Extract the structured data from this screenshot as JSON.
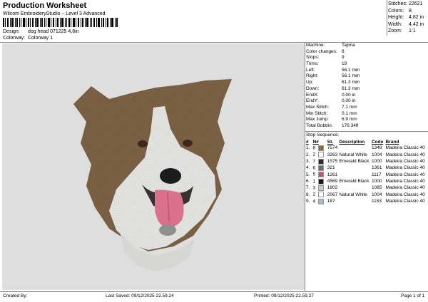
{
  "header": {
    "title": "Production Worksheet",
    "subtitle": "Wilcom EmbroideryStudio – Level 3 Advanced",
    "design_label": "Design:",
    "design_value": "dog head 071225 4,8in",
    "colorway_label": "Colorway:",
    "colorway_value": "Colorway 1"
  },
  "stats": [
    {
      "label": "Stitches:",
      "value": "22621"
    },
    {
      "label": "Colors:",
      "value": "8"
    },
    {
      "label": "Height:",
      "value": "4.82 in"
    },
    {
      "label": "Width:",
      "value": "4.42 in"
    },
    {
      "label": "Zoom:",
      "value": "1:1"
    }
  ],
  "info": [
    {
      "label": "Machine:",
      "value": "Tajima"
    },
    {
      "label": "Color changes:",
      "value": "8"
    },
    {
      "label": "Stops:",
      "value": "9"
    },
    {
      "label": "Trims:",
      "value": "19"
    },
    {
      "label": "Left:",
      "value": "56.1 mm"
    },
    {
      "label": "Right:",
      "value": "56.1 mm"
    },
    {
      "label": "Up:",
      "value": "61.3 mm"
    },
    {
      "label": "Down:",
      "value": "61.3 mm"
    },
    {
      "label": "EndX:",
      "value": "0.00 in"
    },
    {
      "label": "EndY:",
      "value": "0.00 in"
    },
    {
      "label": "Max Stitch:",
      "value": "7.1 mm"
    },
    {
      "label": "Min Stitch:",
      "value": "0.1 mm"
    },
    {
      "label": "Max Jump:",
      "value": "6.9 mm"
    },
    {
      "label": "Total Bobbin:",
      "value": "176.34ft"
    }
  ],
  "stop_sequence": {
    "title": "Stop Sequence:",
    "headers": [
      "#",
      "N#",
      "St.",
      "Description",
      "Code",
      "Brand"
    ],
    "rows": [
      {
        "n": "1.",
        "needle": "8",
        "color": "#8a6a45",
        "st": "7574",
        "desc": "",
        "code": "1348",
        "brand": "Madeira Classic 40"
      },
      {
        "n": "2.",
        "needle": "2",
        "color": "#ffffff",
        "st": "3263",
        "desc": "Natural White",
        "code": "1004",
        "brand": "Madeira Classic 40"
      },
      {
        "n": "3.",
        "needle": "7",
        "color": "#2a2a2a",
        "st": "1575",
        "desc": "Emerald Black",
        "code": "1000",
        "brand": "Madeira Classic 40"
      },
      {
        "n": "4.",
        "needle": "6",
        "color": "#6e6e6e",
        "st": "321",
        "desc": "",
        "code": "1361",
        "brand": "Madeira Classic 40"
      },
      {
        "n": "5.",
        "needle": "5",
        "color": "#c4566e",
        "st": "1261",
        "desc": "",
        "code": "1117",
        "brand": "Madeira Classic 40"
      },
      {
        "n": "6.",
        "needle": "1",
        "color": "#1a1a1a",
        "st": "4569",
        "desc": "Emerald Black",
        "code": "1000",
        "brand": "Madeira Classic 40"
      },
      {
        "n": "7.",
        "needle": "3",
        "color": "#c9c9c9",
        "st": "1802",
        "desc": "",
        "code": "1085",
        "brand": "Madeira Classic 40"
      },
      {
        "n": "8.",
        "needle": "2",
        "color": "#ffffff",
        "st": "2067",
        "desc": "Natural White",
        "code": "1004",
        "brand": "Madeira Classic 40"
      },
      {
        "n": "9.",
        "needle": "4",
        "color": "#a9b9c9",
        "st": "187",
        "desc": "",
        "code": "1153",
        "brand": "Madeira Classic 40"
      }
    ]
  },
  "footer": {
    "created_by": "Created By:",
    "last_saved": "Last Saved: 09/12/2025 22.59.24",
    "printed": "Printed: 09/12/2025 22.59.27",
    "page": "Page 1 of 1"
  }
}
